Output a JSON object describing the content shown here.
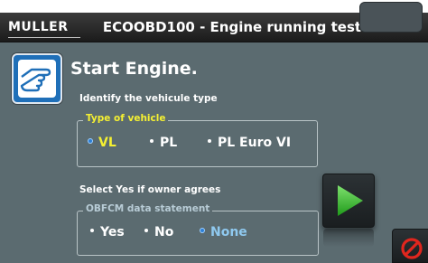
{
  "header": {
    "logo_text": "MULLER",
    "title": "ECOOBD100 - Engine running test"
  },
  "step": {
    "icon": "pointing-hand-icon",
    "heading": "Start Engine.",
    "instruction": "Identify the vehicule type"
  },
  "vehicle_group": {
    "legend": "Type of vehicle",
    "options": [
      {
        "label": "VL",
        "selected": true
      },
      {
        "label": "PL",
        "selected": false
      },
      {
        "label": "PL Euro VI",
        "selected": false
      }
    ]
  },
  "owner_prompt": "Select Yes if owner agrees",
  "obfcm_group": {
    "legend": "OBFCM data statement",
    "options": [
      {
        "label": "Yes",
        "selected": false
      },
      {
        "label": "No",
        "selected": false
      },
      {
        "label": "None",
        "selected": true
      }
    ]
  },
  "actions": {
    "play_icon": "play-icon",
    "stop_icon": "cancel-icon"
  },
  "colors": {
    "background": "#5b6b70",
    "legend_vehicle": "#f5f032",
    "selected_blue": "#8fc9ef",
    "play_green": "#37c22e",
    "stop_red": "#e0261e"
  }
}
